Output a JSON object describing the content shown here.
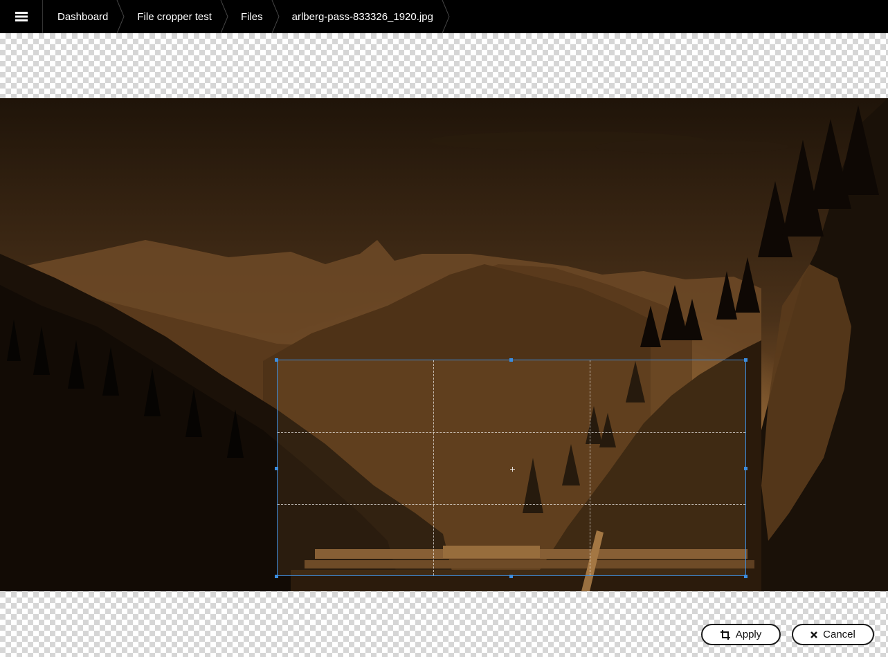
{
  "topbar": {
    "menu_icon": "hamburger-menu-icon",
    "breadcrumbs": [
      "Dashboard",
      "File cropper test",
      "Files",
      "arlberg-pass-833326_1920.jpg"
    ]
  },
  "image": {
    "file_name": "arlberg-pass-833326_1920.jpg",
    "tone": "sepia"
  },
  "actions": {
    "apply_label": "Apply",
    "apply_icon": "crop-icon",
    "cancel_label": "Cancel",
    "cancel_icon": "close-icon"
  },
  "colors": {
    "topbar_bg": "#000000",
    "crop_border": "#3b8de0",
    "button_border": "#1a1a1a"
  }
}
